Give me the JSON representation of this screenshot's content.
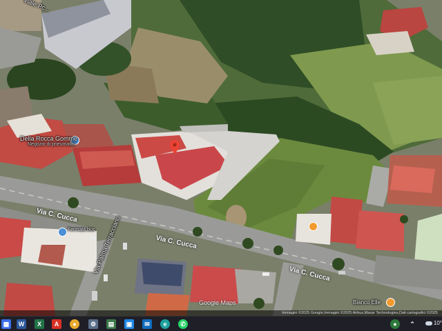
{
  "map": {
    "streets": {
      "via_c_cucca_1": "Via C. Cucca",
      "via_c_cucca_2": "Via C. Cucca",
      "via_c_cucca_3": "Via C. Cucca",
      "via_palma": "Via Palma Terracciano",
      "viale": "Viale Pc..."
    },
    "pois": {
      "della_rocca": "Della Rocca Gomme",
      "della_rocca_sub": "Negozio di pneumatici",
      "stop": "Fermata bus",
      "bianco": "Bianco Elle"
    },
    "watermark": "Google Maps",
    "attribution": "Immagini ©2025 Google,Immagini ©2025 Airbus,Maxar Technologies,Dati cartografici ©2025"
  },
  "taskbar": {
    "icons": [
      "windows-start",
      "word",
      "excel",
      "acrobat",
      "chrome",
      "tool",
      "calculator",
      "photos",
      "mail",
      "edge",
      "whatsapp"
    ],
    "weather": "10°"
  }
}
